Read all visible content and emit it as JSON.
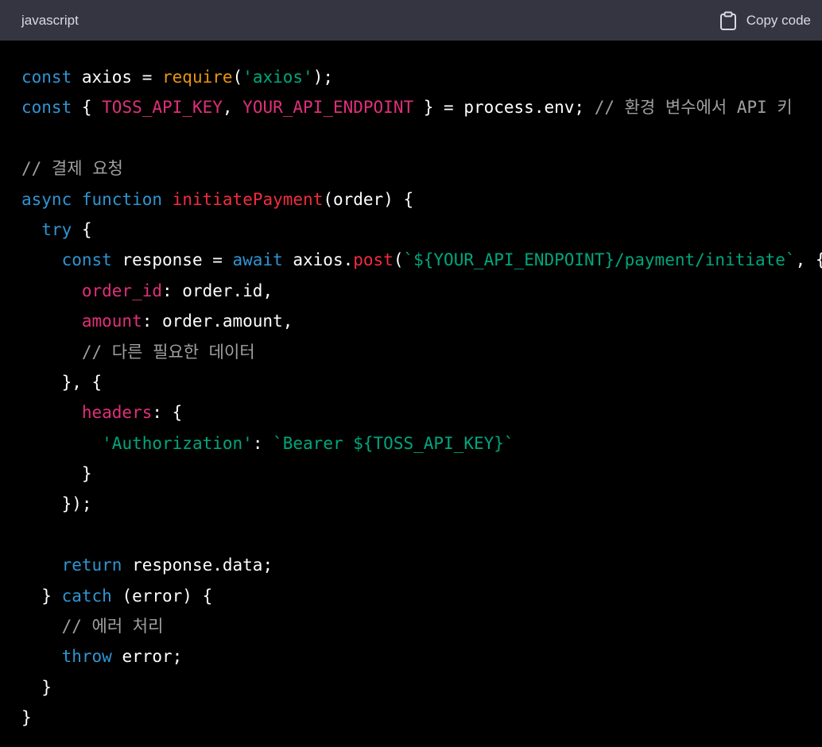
{
  "header": {
    "language": "javascript",
    "copy_label": "Copy code",
    "copy_icon": "clipboard-icon"
  },
  "code_lines": [
    [
      [
        "kw",
        "const"
      ],
      [
        "pl",
        " axios = "
      ],
      [
        "req",
        "require"
      ],
      [
        "pl",
        "("
      ],
      [
        "str",
        "'axios'"
      ],
      [
        "pl",
        ");"
      ]
    ],
    [
      [
        "kw",
        "const"
      ],
      [
        "pl",
        " { "
      ],
      [
        "prop",
        "TOSS_API_KEY"
      ],
      [
        "pl",
        ", "
      ],
      [
        "prop",
        "YOUR_API_ENDPOINT"
      ],
      [
        "pl",
        " } = process.env; "
      ],
      [
        "cm",
        "// 환경 변수에서 API 키"
      ]
    ],
    [],
    [
      [
        "cm",
        "// 결제 요청"
      ]
    ],
    [
      [
        "kw",
        "async"
      ],
      [
        "pl",
        " "
      ],
      [
        "kw",
        "function"
      ],
      [
        "pl",
        " "
      ],
      [
        "fn",
        "initiatePayment"
      ],
      [
        "pl",
        "(order) {"
      ]
    ],
    [
      [
        "pl",
        "  "
      ],
      [
        "kw",
        "try"
      ],
      [
        "pl",
        " {"
      ]
    ],
    [
      [
        "pl",
        "    "
      ],
      [
        "kw",
        "const"
      ],
      [
        "pl",
        " response = "
      ],
      [
        "kw",
        "await"
      ],
      [
        "pl",
        " axios."
      ],
      [
        "fn",
        "post"
      ],
      [
        "pl",
        "("
      ],
      [
        "str",
        "`${YOUR_API_ENDPOINT}/payment/initiate`"
      ],
      [
        "pl",
        ", {"
      ]
    ],
    [
      [
        "pl",
        "      "
      ],
      [
        "prop",
        "order_id"
      ],
      [
        "pl",
        ": order.id,"
      ]
    ],
    [
      [
        "pl",
        "      "
      ],
      [
        "prop",
        "amount"
      ],
      [
        "pl",
        ": order.amount,"
      ]
    ],
    [
      [
        "pl",
        "      "
      ],
      [
        "cm",
        "// 다른 필요한 데이터"
      ]
    ],
    [
      [
        "pl",
        "    }, {"
      ]
    ],
    [
      [
        "pl",
        "      "
      ],
      [
        "prop",
        "headers"
      ],
      [
        "pl",
        ": {"
      ]
    ],
    [
      [
        "pl",
        "        "
      ],
      [
        "str",
        "'Authorization'"
      ],
      [
        "pl",
        ": "
      ],
      [
        "str",
        "`Bearer ${TOSS_API_KEY}`"
      ]
    ],
    [
      [
        "pl",
        "      }"
      ]
    ],
    [
      [
        "pl",
        "    });"
      ]
    ],
    [],
    [
      [
        "pl",
        "    "
      ],
      [
        "kw",
        "return"
      ],
      [
        "pl",
        " response.data;"
      ]
    ],
    [
      [
        "pl",
        "  } "
      ],
      [
        "kw",
        "catch"
      ],
      [
        "pl",
        " (error) {"
      ]
    ],
    [
      [
        "pl",
        "    "
      ],
      [
        "cm",
        "// 에러 처리"
      ]
    ],
    [
      [
        "pl",
        "    "
      ],
      [
        "kw",
        "throw"
      ],
      [
        "pl",
        " error;"
      ]
    ],
    [
      [
        "pl",
        "  }"
      ]
    ],
    [
      [
        "pl",
        "}"
      ]
    ]
  ]
}
